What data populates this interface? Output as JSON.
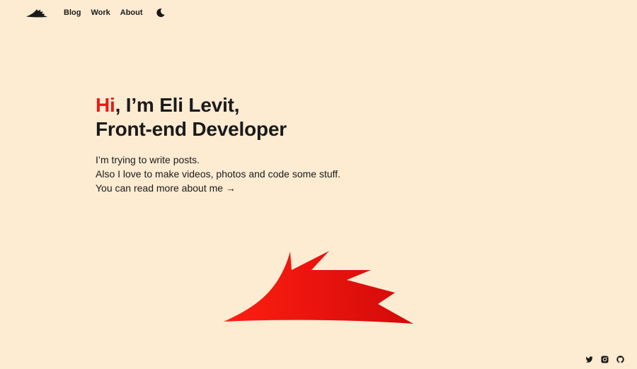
{
  "nav": {
    "logo_icon": "hedgehog-logo-icon",
    "links": [
      "Blog",
      "Work",
      "About"
    ],
    "theme_toggle_icon": "moon-icon"
  },
  "hero": {
    "greeting": "Hi",
    "title_rest": ", I’m Eli Levit,",
    "title_line2": "Front-end Developer",
    "lines": [
      "I’m trying to write posts.",
      "Also I love to make videos, photos and code some stuff."
    ],
    "about_link": "You can read more about me →"
  },
  "footer": {
    "social_icons": [
      "twitter-icon",
      "instagram-icon",
      "github-icon"
    ]
  },
  "colors": {
    "background": "#fdebd2",
    "accent": "#e41b17",
    "text": "#1a1a1a"
  }
}
